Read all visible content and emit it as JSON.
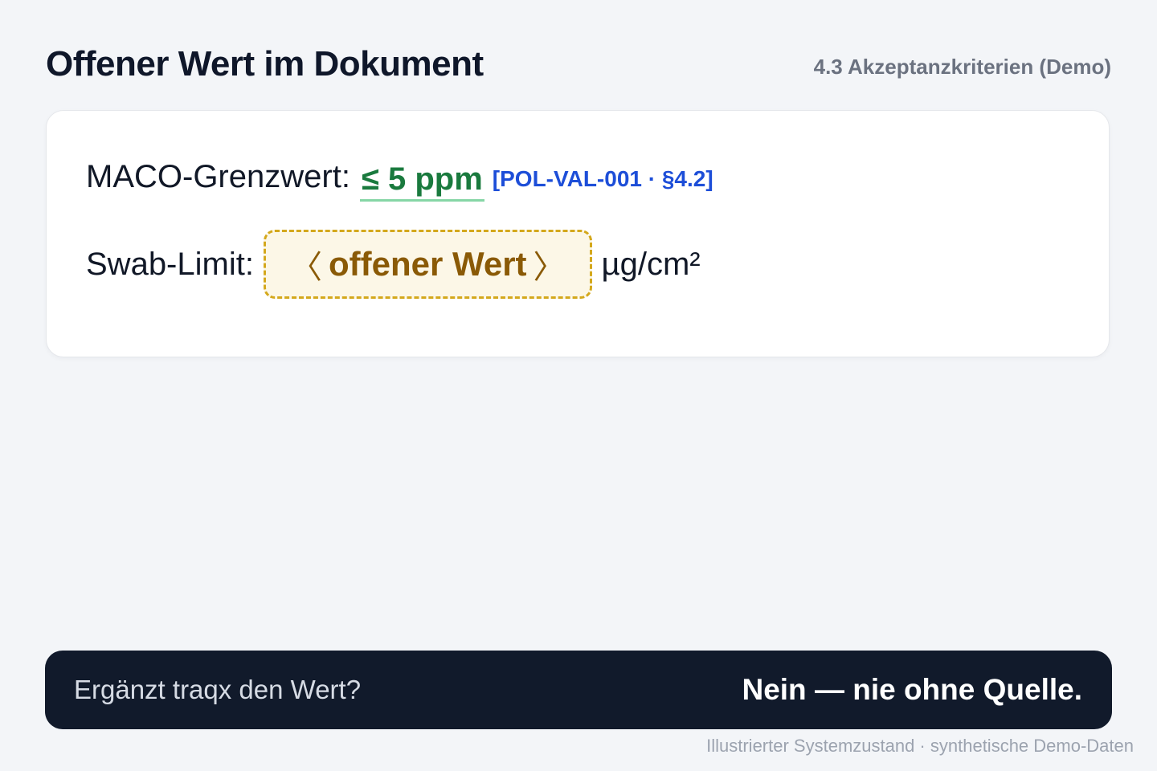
{
  "header": {
    "title": "Offener Wert im Dokument",
    "section": "4.3 Akzeptanzkriterien (Demo)"
  },
  "card": {
    "maco": {
      "label": "MACO-Grenzwert:",
      "value": "≤ 5 ppm",
      "citation": "[POL-VAL-001 · §4.2]"
    },
    "swab": {
      "label": "Swab-Limit:",
      "open_left": "〈",
      "open_value": "offener Wert",
      "open_right": "〉",
      "unit": "µg/cm²"
    }
  },
  "banner": {
    "question": "Ergänzt traqx den Wert?",
    "answer": "Nein — nie ohne Quelle."
  },
  "footer": {
    "note": "Illustrierter Systemzustand · synthetische Demo-Daten"
  },
  "colors": {
    "background": "#f3f5f8",
    "value_ok": "#1a7a3e",
    "citation": "#1d4ed8",
    "open_value_text": "#8a5a06",
    "open_value_border": "#d4a81c",
    "banner_bg": "#111a2b"
  }
}
